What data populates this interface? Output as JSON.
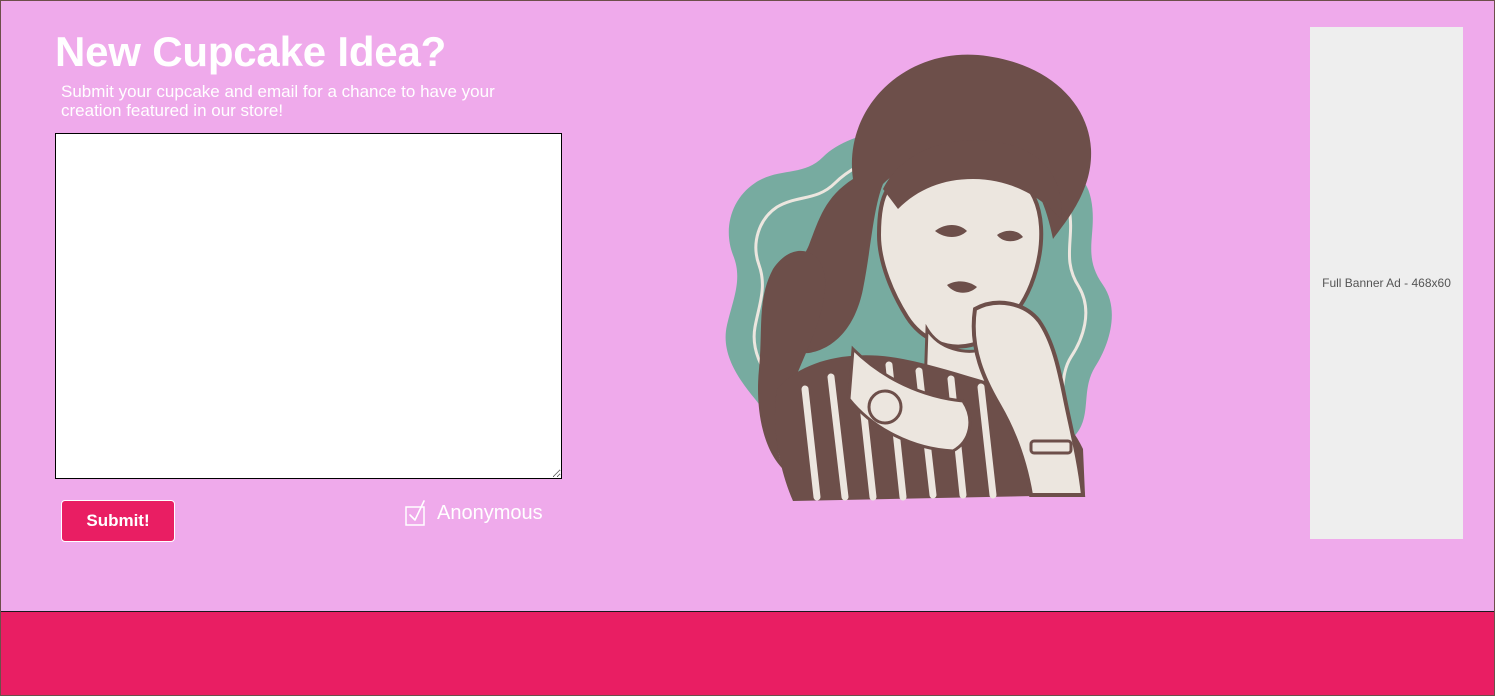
{
  "form": {
    "title": "New Cupcake Idea?",
    "subtitle": "Submit your cupcake and email for a chance to have your creation featured in our store!",
    "idea_value": "",
    "submit_label": "Submit!",
    "anonymous_label": "Anonymous",
    "anonymous_checked": true
  },
  "illustration": {
    "icon": "retro-woman-illustration",
    "colors": {
      "badge": "#77aba0",
      "hair": "#6d4f4a",
      "skin": "#ece6df"
    }
  },
  "ad": {
    "label": "Full Banner Ad - 468x60"
  },
  "colors": {
    "background": "#efaaeb",
    "accent": "#e91e63",
    "ad_background": "#eeeeee"
  }
}
